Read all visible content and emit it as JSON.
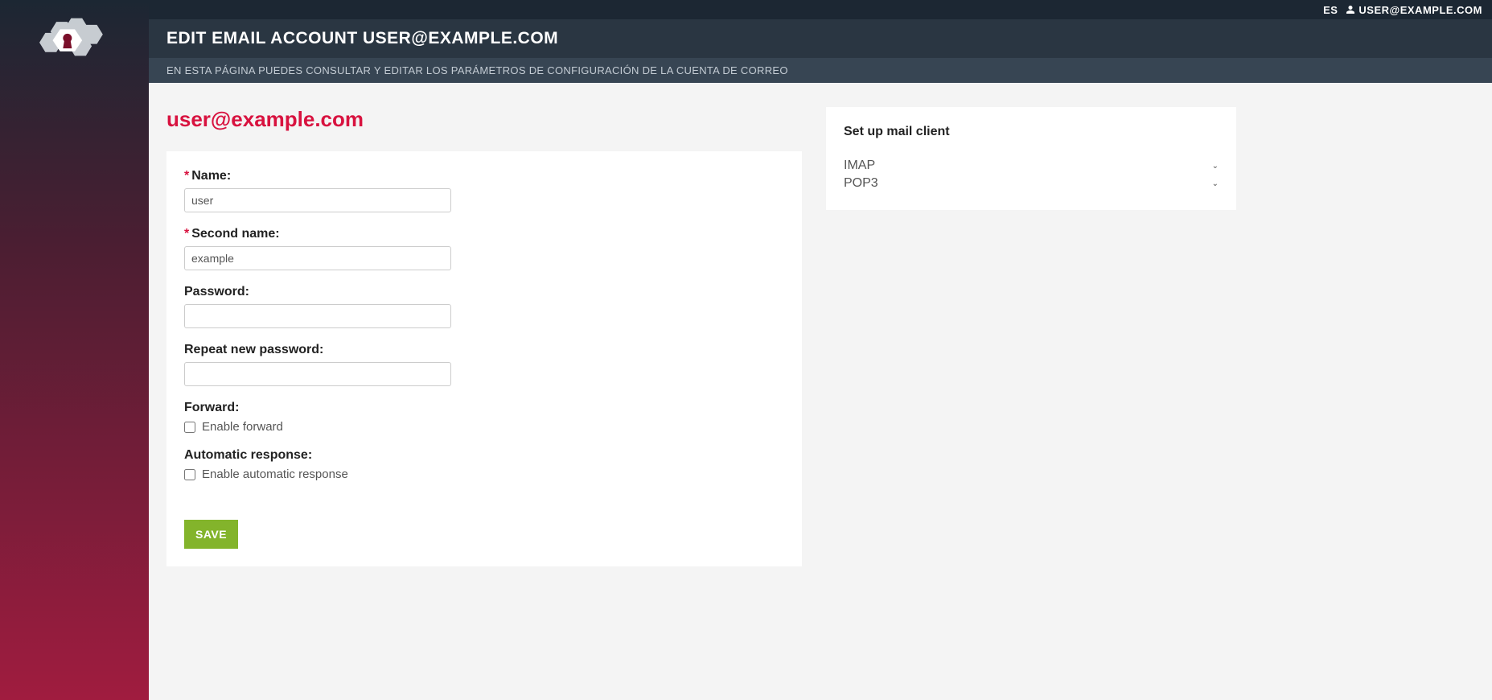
{
  "topbar": {
    "lang": "ES",
    "user": "USER@EXAMPLE.COM"
  },
  "header": {
    "title": "EDIT EMAIL ACCOUNT USER@EXAMPLE.COM",
    "subtitle": "EN ESTA PÁGINA PUEDES CONSULTAR Y EDITAR LOS PARÁMETROS DE CONFIGURACIÓN DE LA CUENTA DE CORREO"
  },
  "email_heading": "user@example.com",
  "form": {
    "name_label": "Name:",
    "name_value": "user",
    "second_name_label": "Second name:",
    "second_name_value": "example",
    "password_label": "Password:",
    "password_value": "",
    "repeat_password_label": "Repeat new password:",
    "repeat_password_value": "",
    "forward_label": "Forward:",
    "enable_forward_label": "Enable forward",
    "autoresponse_label": "Automatic response:",
    "enable_autoresponse_label": "Enable automatic response",
    "save_label": "SAVE"
  },
  "sidebar_right": {
    "title": "Set up mail client",
    "items": [
      "IMAP",
      "POP3"
    ]
  }
}
